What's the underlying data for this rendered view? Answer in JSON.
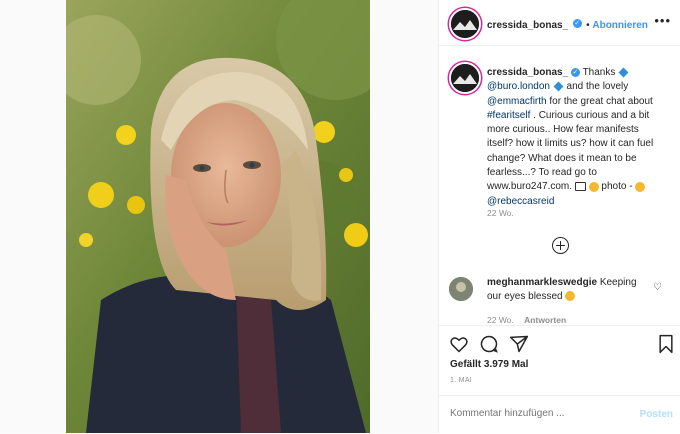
{
  "post": {
    "author": "cressida_bonas_",
    "follow_label": "Abonnieren",
    "more_icon": "more-horizontal-icon"
  },
  "caption": {
    "author": "cressida_bonas_",
    "t1": "Thanks",
    "m1": "@buro.london",
    "t2": "and the lovely",
    "m2": "@emmacfirth",
    "t3": "for the great chat about",
    "h1": "#fearitself",
    "t4": ". Curious curious and a bit more curious.. How fear manifests itself? how it limits us? how it can fuel change? What does it mean to be fearless...? To read go to www.buro247.com.",
    "t5": "photo -",
    "m3": "@rebeccasreid",
    "time": "22 Wo."
  },
  "comment": {
    "author": "meghanmarkleswedgie",
    "text": "Keeping our eyes blessed",
    "time": "22 Wo.",
    "reply_label": "Antworten"
  },
  "likes_text": "Gefällt 3.979 Mal",
  "date": "1. MAI",
  "input": {
    "placeholder": "Kommentar hinzufügen ..."
  },
  "post_button": "Posten",
  "colors": {
    "link": "#00376b",
    "accent": "#3897f0",
    "verified": "#3897f0"
  }
}
